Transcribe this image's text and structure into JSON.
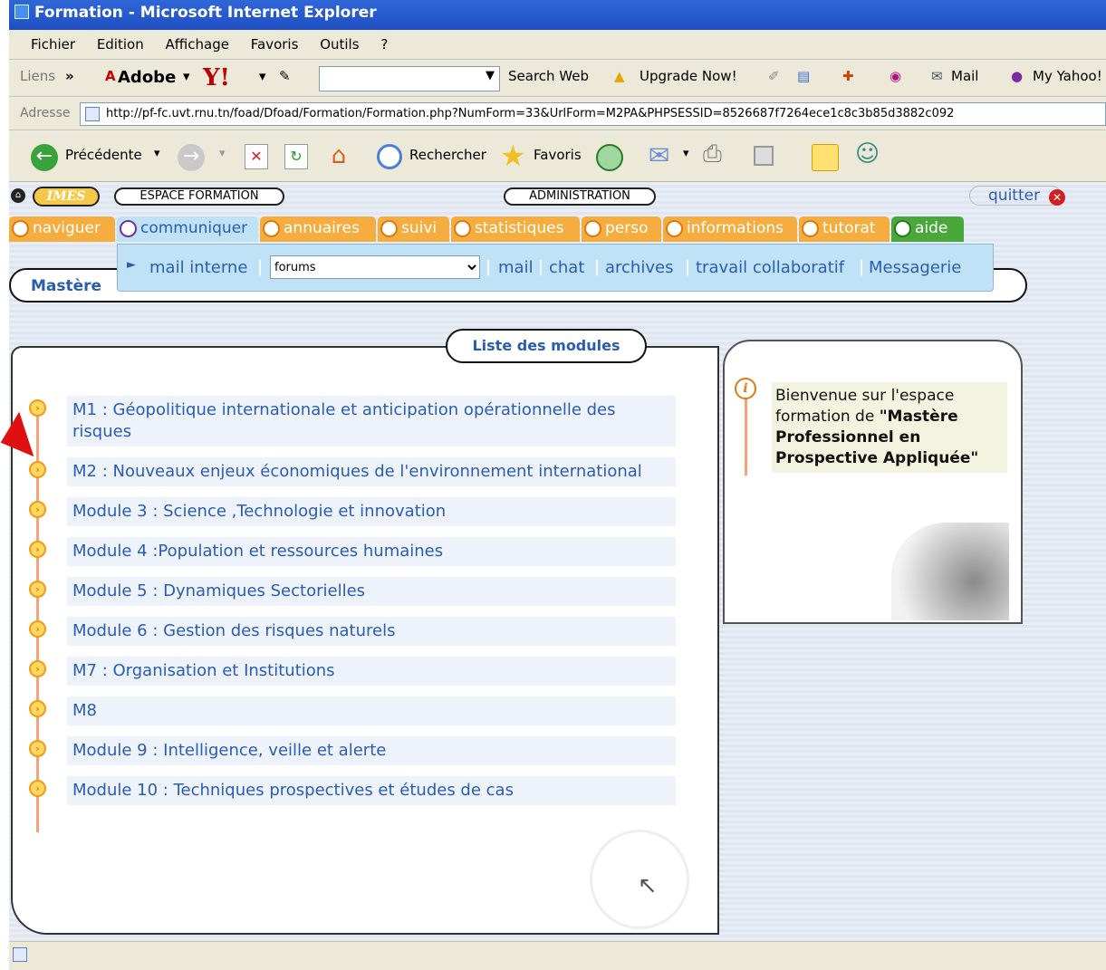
{
  "window": {
    "title": "Formation - Microsoft Internet Explorer"
  },
  "menu": [
    "Fichier",
    "Edition",
    "Affichage",
    "Favoris",
    "Outils",
    "?"
  ],
  "links_bar": {
    "liens": "Liens",
    "adobe": "Adobe",
    "yahoo": "Y!",
    "search_web": "Search Web",
    "upgrade": "Upgrade Now!",
    "mail": "Mail",
    "my_yahoo": "My Yahoo!"
  },
  "address": {
    "label": "Adresse",
    "url": "http://pf-fc.uvt.rnu.tn/foad/Dfoad/Formation/Formation.php?NumForm=33&UrlForm=M2PA&PHPSESSID=8526687f7264ece1c8c3b85d3882c092"
  },
  "toolbar": {
    "back": "Précédente",
    "search": "Rechercher",
    "favorites": "Favoris"
  },
  "site": {
    "logo": "IMES",
    "espace": "ESPACE FORMATION",
    "admin": "ADMINISTRATION",
    "quit": "quitter"
  },
  "tabs": [
    {
      "label": "naviguer"
    },
    {
      "label": "communiquer"
    },
    {
      "label": "annuaires"
    },
    {
      "label": "suivi"
    },
    {
      "label": "statistiques"
    },
    {
      "label": "perso"
    },
    {
      "label": "informations"
    },
    {
      "label": "tutorat"
    },
    {
      "label": "aide"
    }
  ],
  "submenu": {
    "mail_interne": "mail interne",
    "select_value": "forums",
    "items": [
      "mail",
      "chat",
      "archives",
      "travail collaboratif",
      "Messagerie"
    ]
  },
  "page_title": "Mastère",
  "modules_header": "Liste des modules",
  "modules": [
    "M1 : Géopolitique internationale et anticipation opérationnelle des risques",
    "M2 : Nouveaux enjeux économiques de l'environnement international",
    "Module 3 : Science ,Technologie et innovation",
    "Module 4 :Population et ressources humaines",
    "Module 5 : Dynamiques Sectorielles",
    "Module 6 : Gestion des risques naturels",
    "M7 : Organisation et Institutions",
    "M8",
    "Module 9 : Intelligence, veille et alerte",
    "Module 10 : Techniques prospectives et études de cas"
  ],
  "welcome": {
    "intro": "Bienvenue sur l'espace formation de ",
    "name": "\"Mastère Professionnel en Prospective Appliquée\""
  },
  "colors": {
    "link": "#2a5db0",
    "tab": "#f5ad3f",
    "accent": "#e07a10",
    "active_tab": "#bfe2f7"
  }
}
